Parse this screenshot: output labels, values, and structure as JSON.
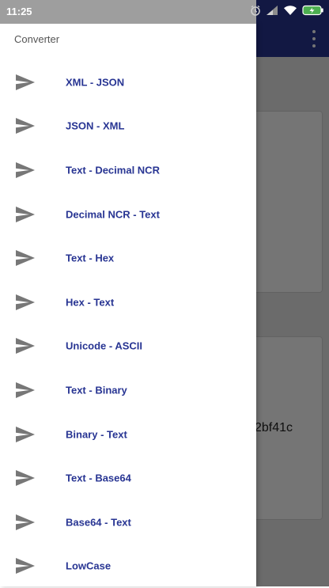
{
  "colors": {
    "primary": "#283593",
    "nav_label": "#283593",
    "icon": "#777777",
    "status_bar": "#9e9e9e",
    "battery": "#4caf50"
  },
  "status_bar": {
    "time": "11:25",
    "icons": [
      "alarm-icon",
      "signal-icon",
      "wifi-icon",
      "battery-icon"
    ]
  },
  "background": {
    "output_fragment": "2bf41c"
  },
  "drawer": {
    "title": "Converter",
    "items": [
      {
        "label": "XML - JSON",
        "icon": "send-icon"
      },
      {
        "label": "JSON - XML",
        "icon": "send-icon"
      },
      {
        "label": "Text - Decimal NCR",
        "icon": "send-icon"
      },
      {
        "label": "Decimal NCR - Text",
        "icon": "send-icon"
      },
      {
        "label": "Text - Hex",
        "icon": "send-icon"
      },
      {
        "label": "Hex - Text",
        "icon": "send-icon"
      },
      {
        "label": "Unicode - ASCII",
        "icon": "send-icon"
      },
      {
        "label": "Text - Binary",
        "icon": "send-icon"
      },
      {
        "label": "Binary - Text",
        "icon": "send-icon"
      },
      {
        "label": "Text - Base64",
        "icon": "send-icon"
      },
      {
        "label": "Base64 - Text",
        "icon": "send-icon"
      },
      {
        "label": "LowCase",
        "icon": "send-icon"
      }
    ]
  }
}
